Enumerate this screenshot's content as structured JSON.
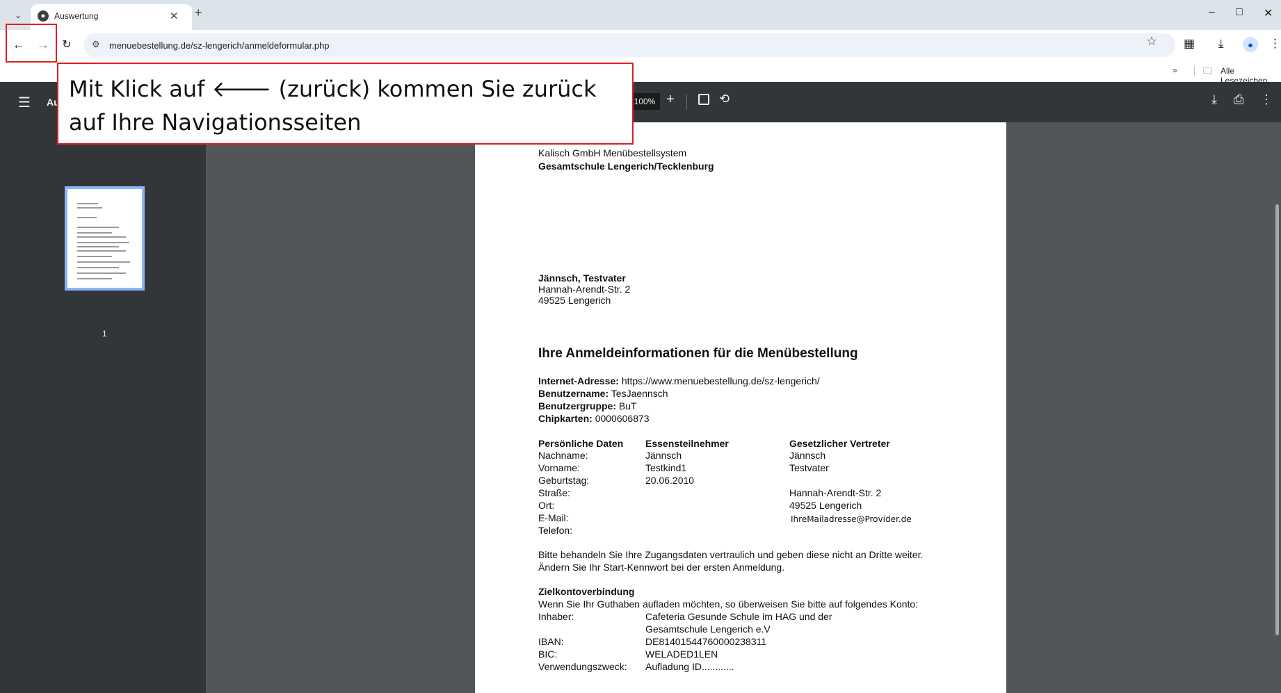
{
  "browser": {
    "tab_title": "Auswertung",
    "url": "menuebestellung.de/sz-lengerich/anmeldeformular.php",
    "bookmarks_label": "Alle Lesezeichen"
  },
  "pdf": {
    "title": "Au",
    "zoom": "100%",
    "page_number": "1"
  },
  "annotation": {
    "line1": "Mit Klick auf 🡐 (zurück) kommen Sie zurück",
    "line2": "auf Ihre Navigationsseiten"
  },
  "document": {
    "header1": "Kalisch GmbH Menübestellsystem",
    "header2": "Gesamtschule Lengerich/Tecklenburg",
    "addr_name": "Jännsch, Testvater",
    "addr_street": "Hannah-Arendt-Str. 2",
    "addr_city": "49525 Lengerich",
    "heading": "Ihre Anmeldeinformationen für die Menübestellung",
    "info": [
      {
        "label": "Internet-Adresse:",
        "value": "https://www.menuebestellung.de/sz-lengerich/"
      },
      {
        "label": "Benutzername:",
        "value": "TesJaennsch"
      },
      {
        "label": "Benutzergruppe:",
        "value": "BuT"
      },
      {
        "label": "Chipkarten:",
        "value": "0000606873"
      }
    ],
    "table_headers": [
      "Persönliche Daten",
      "Essensteilnehmer",
      "Gesetzlicher Vertreter"
    ],
    "table_rows": [
      [
        "Nachname:",
        "Jännsch",
        "Jännsch"
      ],
      [
        "Vorname:",
        "Testkind1",
        "Testvater"
      ],
      [
        "Geburtstag:",
        "20.06.2010",
        ""
      ],
      [
        "Straße:",
        "",
        "Hannah-Arendt-Str. 2"
      ],
      [
        "Ort:",
        "",
        "49525 Lengerich"
      ],
      [
        "E-Mail:",
        "",
        "IhreMailadresse@Provider.de"
      ],
      [
        "Telefon:",
        "",
        ""
      ]
    ],
    "notice1": "Bitte behandeln Sie Ihre Zugangsdaten vertraulich und geben diese nicht an Dritte weiter.",
    "notice2": "Ändern Sie Ihr Start-Kennwort bei der ersten Anmeldung.",
    "account_heading": "Zielkontoverbindung",
    "account_intro": "Wenn Sie Ihr Guthaben aufladen möchten, so überweisen Sie bitte auf folgendes Konto:",
    "account_rows": [
      {
        "label": "Inhaber:",
        "value": "Cafeteria Gesunde Schule im HAG und der"
      },
      {
        "label": "",
        "value": "Gesamtschule Lengerich e.V"
      },
      {
        "label": "IBAN:",
        "value": "DE81401544760000238311"
      },
      {
        "label": "BIC:",
        "value": "WELADED1LEN"
      },
      {
        "label": "Verwendungszweck:",
        "value": "Aufladung ID............"
      }
    ]
  },
  "icons": [
    "tab-search-icon",
    "globe-icon",
    "close-icon",
    "new-tab-icon",
    "minimize-icon",
    "maximize-icon",
    "window-close-icon",
    "back-arrow-icon",
    "forward-arrow-icon",
    "reload-icon",
    "site-settings-icon",
    "star-icon",
    "extensions-icon",
    "download-icon",
    "profile-icon",
    "kebab-menu-icon",
    "chevron-icon",
    "folder-icon",
    "hamburger-icon",
    "zoom-in-icon",
    "fit-page-icon",
    "rotate-icon",
    "print-icon"
  ]
}
